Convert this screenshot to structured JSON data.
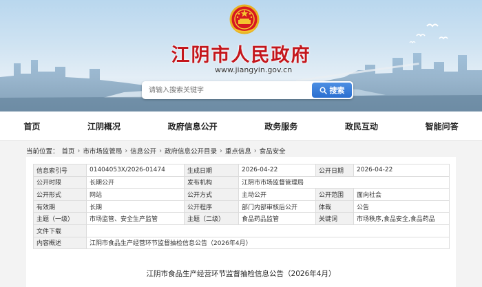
{
  "banner": {
    "site_title": "江阴市人民政府",
    "site_url": "www.jiangyin.gov.cn",
    "search_placeholder": "请输入搜索关键字",
    "search_button": "搜索"
  },
  "nav": {
    "items": [
      "首页",
      "江阴概况",
      "政府信息公开",
      "政务服务",
      "政民互动",
      "智能问答"
    ]
  },
  "breadcrumb": {
    "prefix": "当前位置：",
    "items": [
      "首页",
      "市市场监管局",
      "信息公开",
      "政府信息公开目录",
      "重点信息",
      "食品安全"
    ],
    "separator": "›"
  },
  "info": {
    "index_label": "信息索引号",
    "index_value": "01404053X/2026-01474",
    "gen_date_label": "生成日期",
    "gen_date_value": "2026-04-22",
    "pub_date_label": "公开日期",
    "pub_date_value": "2026-04-22",
    "period_label": "公开时限",
    "period_value": "长期公开",
    "org_label": "发布机构",
    "org_value": "江阴市市场监督管理局",
    "form_label": "公开形式",
    "form_value": "网站",
    "method_label": "公开方式",
    "method_value": "主动公开",
    "scope_label": "公开范围",
    "scope_value": "面向社会",
    "validity_label": "有效期",
    "validity_value": "长期",
    "procedure_label": "公开程序",
    "procedure_value": "部门内部审核后公开",
    "genre_label": "体裁",
    "genre_value": "公告",
    "topic1_label": "主题（一级）",
    "topic1_value": "市场监管、安全生产监管",
    "topic2_label": "主题（二级）",
    "topic2_value": "食品药品监管",
    "keywords_label": "关键词",
    "keywords_value": "市场秩序,食品安全,食品药品",
    "download_label": "文件下载",
    "download_value": "",
    "summary_label": "内容概述",
    "summary_value": "江阴市食品生产经营环节监督抽检信息公告（2026年4月）"
  },
  "document": {
    "title": "江阴市食品生产经营环节监督抽检信息公告（2026年4月）"
  },
  "colors": {
    "title_red": "#c4161c",
    "search_blue": "#2a6fd0"
  }
}
